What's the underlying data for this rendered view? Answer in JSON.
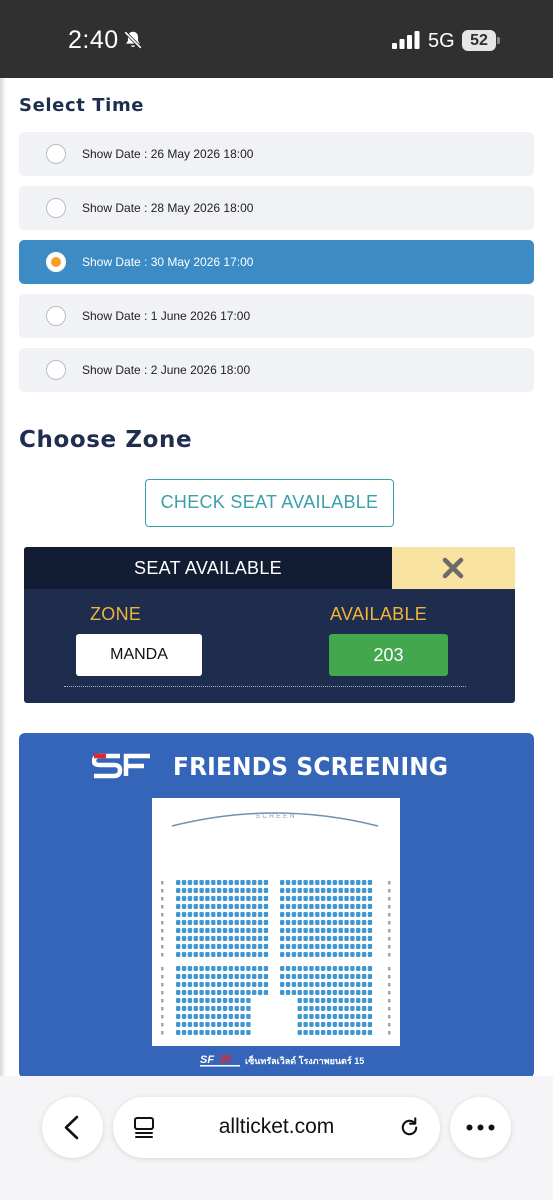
{
  "status_bar": {
    "time": "2:40",
    "network": "5G",
    "battery": "52",
    "icons": [
      "bell-slash-icon",
      "signal-icon",
      "battery-icon"
    ]
  },
  "select_time": {
    "title": "Select Time",
    "options": [
      {
        "label": "Show Date : 26 May 2026 18:00",
        "selected": false
      },
      {
        "label": "Show Date : 28 May 2026 18:00",
        "selected": false
      },
      {
        "label": "Show Date : 30 May 2026 17:00",
        "selected": true
      },
      {
        "label": "Show Date : 1 June 2026 17:00",
        "selected": false
      },
      {
        "label": "Show Date : 2 June 2026 18:00",
        "selected": false
      }
    ]
  },
  "choose_zone": {
    "title": "Choose Zone",
    "check_button": "CHECK SEAT AVAILABLE"
  },
  "seat_available": {
    "header": "SEAT AVAILABLE",
    "close_icon": "close-icon",
    "zone_label": "ZONE",
    "available_label": "AVAILABLE",
    "zone_value": "MANDA",
    "available_value": "203"
  },
  "seat_map": {
    "title": "FRIENDS SCREENING",
    "screen_label": "SCREEN",
    "logo": "SF",
    "cinema_logo": "SFW",
    "cinema_name": "เซ็นทรัลเวิลด์ โรงภาพยนตร์ 15"
  },
  "browser": {
    "url": "allticket.com",
    "icons": [
      "back-icon",
      "tabs-icon",
      "reload-icon",
      "more-icon"
    ]
  },
  "colors": {
    "selected_option": "#3d8bc5",
    "title": "#1f2d4e",
    "accent_teal": "#3aa0aa",
    "panel_bg": "#1e2d4d",
    "zone_label": "#f0b43c",
    "available_green": "#43a84d",
    "seatmap_bg": "#3465b8"
  }
}
